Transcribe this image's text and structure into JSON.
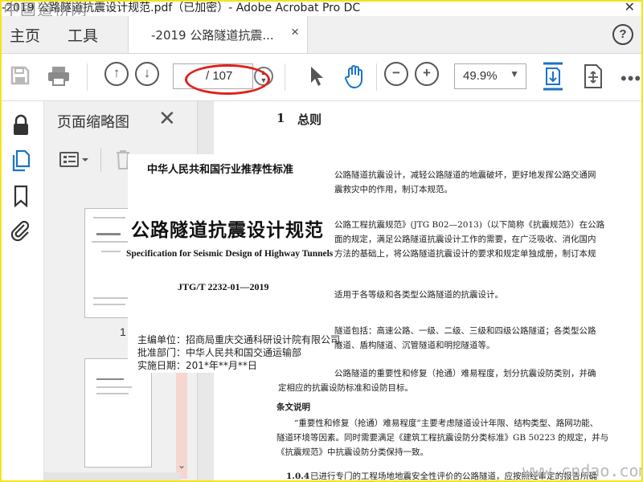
{
  "window": {
    "title": "-2019 公路隧道抗震设计规范.pdf（已加密）- Adobe Acrobat Pro DC",
    "watermark_top": "中国道桥网"
  },
  "menu": {
    "home": "主页",
    "tools": "工具"
  },
  "tab": {
    "label": "-2019 公路隧道抗震...",
    "close": "×"
  },
  "help": "?",
  "toolbar": {
    "current_page": "",
    "total_pages": "/ 107",
    "zoom": "49.9%"
  },
  "thumbnails": {
    "title": "页面缩略图",
    "page_label_1": "1"
  },
  "cover": {
    "standard": "中华人民共和国行业推荐性标准",
    "title": "公路隧道抗震设计规范",
    "english": "Specification for Seismic Design of Highway Tunnels",
    "code": "JTG/T 2232-01—2019",
    "editor": "主编单位：招商局重庆交通科研设计院有限公司",
    "approver": "批准部门：中华人民共和国交通运输部",
    "effective": "实施日期：201*年**月**日"
  },
  "document": {
    "heading_num": "1",
    "heading": "总则",
    "lines": [
      "公路隧道抗震设计，减轻公路隧道的地震破坏，更好地发挥公路交通网",
      "震救灾中的作用，制订本规范。",
      "公路工程抗震规范》(JTG B02—2013)（以下简称《抗震规范》）在公路",
      "面的规定，满足公路隧道抗震设计工作的需要，在广泛吸收、消化国内",
      "方法的基础上，将公路隧道抗震设计的要求和规定单独成册，制订本规",
      "适用于各等级和各类型公路隧道的抗震设计。",
      "隧道包括：高速公路、一级、二级、三级和四级公路隧道；各类型公路",
      "隧道、盾构隧道、沉管隧道和明挖隧道等。",
      "公路隧道的重要性和修复（抢通）难易程度，划分抗震设防类别，并确",
      "定相应的抗震设防标准和设防目标。",
      "条文说明",
      "“重要性和修复（抢通）难易程度”主要考虑隧道设计年限、结构类型、路网功能、",
      "隧道环境等因素。同时需要满足《建筑工程抗震设防分类标准》GB 50223 的规定，并与",
      "《抗震规范》中抗震设防分类保持一致。",
      "1.0.4",
      "已进行专门的工程场地地震安全性评价的公路隧道，应按照经审定的报告所确"
    ]
  },
  "watermark_bottom": "www.cndao.com",
  "colors": {
    "frame": "#f3e41c",
    "annotation": "#e0201b",
    "accent": "#1a73c8"
  }
}
